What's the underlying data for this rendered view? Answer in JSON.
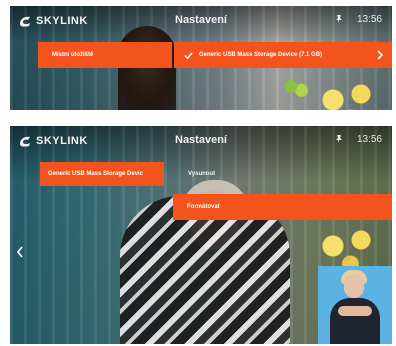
{
  "colors": {
    "accent": "#f3531c",
    "signer_bg": "#5cb2e2"
  },
  "screen1": {
    "logo_text": "SKYLINK",
    "title": "Nastavení",
    "time": "13:56",
    "left_item": "Místní úložiště",
    "right_item": "Generic USB Mass Storage Device (7.1 GB)",
    "icons": {
      "pin": "pin-icon",
      "check": "check-icon",
      "arrow": "chevron-right-icon"
    }
  },
  "screen2": {
    "logo_text": "SKYLINK",
    "title": "Nastavení",
    "time": "13:56",
    "left_item": "Generic USB Mass Storage Devic",
    "menu": [
      "Vysunout",
      "Formátovat"
    ],
    "icons": {
      "pin": "pin-icon",
      "back": "chevron-left-icon"
    }
  }
}
